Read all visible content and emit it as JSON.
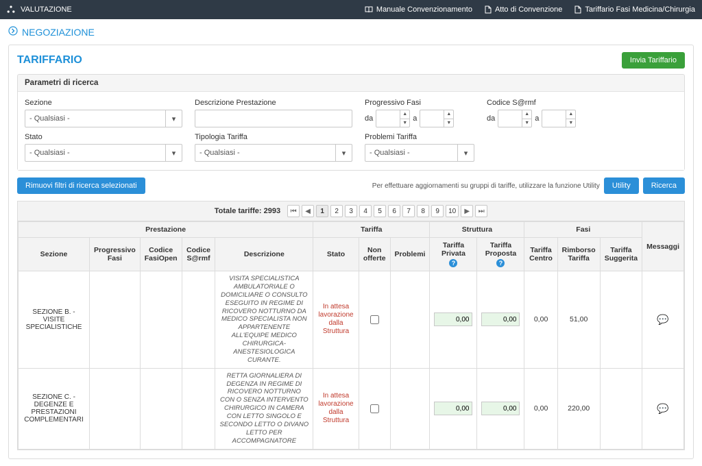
{
  "topbar": {
    "brand": "VALUTAZIONE",
    "links": {
      "manuale": "Manuale Convenzionamento",
      "atto": "Atto di Convenzione",
      "tariffario_fasi": "Tariffario Fasi Medicina/Chirurgia"
    }
  },
  "subheader": {
    "title": "NEGOZIAZIONE"
  },
  "panel": {
    "title": "TARIFFARIO",
    "send_btn": "Invia Tariffario",
    "params_title": "Parametri di ricerca",
    "labels": {
      "sezione": "Sezione",
      "descrizione_prestazione": "Descrizione Prestazione",
      "progressivo_fasi": "Progressivo Fasi",
      "codice_sarmf": "Codice S@rmf",
      "stato": "Stato",
      "tipologia_tariffa": "Tipologia Tariffa",
      "problemi_tariffa": "Problemi Tariffa",
      "da": "da",
      "a": "a"
    },
    "qualsiasi": "- Qualsiasi -",
    "remove_filters_btn": "Rimuovi filtri di ricerca selezionati",
    "hint": "Per effettuare aggiornamenti su gruppi di tariffe, utilizzare la funzione Utility",
    "utility_btn": "Utility",
    "search_btn": "Ricerca"
  },
  "table": {
    "total_label": "Totale tariffe: 2993",
    "pages": [
      "1",
      "2",
      "3",
      "4",
      "5",
      "6",
      "7",
      "8",
      "9",
      "10"
    ],
    "groups": {
      "prestazione": "Prestazione",
      "tariffa": "Tariffa",
      "struttura": "Struttura",
      "fasi": "Fasi"
    },
    "cols": {
      "sezione": "Sezione",
      "progressivo_fasi": "Progressivo Fasi",
      "codice_fasiopen": "Codice FasiOpen",
      "codice_sarmf": "Codice S@rmf",
      "descrizione": "Descrizione",
      "stato": "Stato",
      "non_offerte": "Non offerte",
      "problemi": "Problemi",
      "tariffa_privata": "Tariffa Privata",
      "tariffa_proposta": "Tariffa Proposta",
      "tariffa_centro": "Tariffa Centro",
      "rimborso_tariffa": "Rimborso Tariffa",
      "tariffa_suggerita": "Tariffa Suggerita",
      "messaggi": "Messaggi"
    },
    "rows": [
      {
        "sezione": "SEZIONE B. - VISITE SPECIALISTICHE",
        "descrizione": "VISITA SPECIALISTICA AMBULATORIALE O DOMICILIARE O CONSULTO ESEGUITO IN REGIME DI RICOVERO NOTTURNO DA MEDICO SPECIALISTA NON APPARTENENTE ALL'EQUIPE MEDICO CHIRURGICA-ANESTESIOLOGICA CURANTE.",
        "stato": "In attesa lavorazione dalla Struttura",
        "tariffa_privata": "0,00",
        "tariffa_proposta": "0,00",
        "tariffa_centro": "0,00",
        "rimborso": "51,00"
      },
      {
        "sezione": "SEZIONE C. - DEGENZE E PRESTAZIONI COMPLEMENTARI",
        "descrizione": "RETTA GIORNALIERA DI DEGENZA IN REGIME DI RICOVERO NOTTURNO CON O SENZA INTERVENTO CHIRURGICO IN CAMERA CON LETTO SINGOLO E SECONDO LETTO O DIVANO LETTO PER ACCOMPAGNATORE",
        "stato": "In attesa lavorazione dalla Struttura",
        "tariffa_privata": "0,00",
        "tariffa_proposta": "0,00",
        "tariffa_centro": "0,00",
        "rimborso": "220,00"
      }
    ]
  }
}
